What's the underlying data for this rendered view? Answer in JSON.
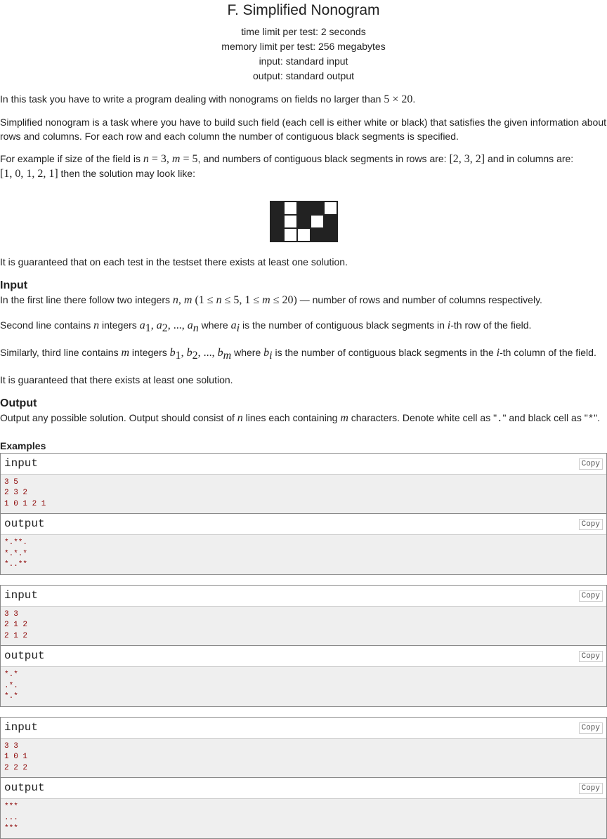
{
  "problem": {
    "title": "F. Simplified Nonogram",
    "time_limit": "time limit per test: 2 seconds",
    "memory_limit": "memory limit per test: 256 megabytes",
    "input_file": "input: standard input",
    "output_file": "output: standard output"
  },
  "statement": {
    "p1_a": "In this task you have to write a program dealing with nonograms on fields no larger than ",
    "p1_math": "5 × 20",
    "p1_b": ".",
    "p2": "Simplified nonogram is a task where you have to build such field (each cell is either white or black) that satisfies the given information about rows and columns. For each row and each column the number of contiguous black segments is specified.",
    "p3_a": "For example if size of the field is ",
    "p3_b": ", and numbers of contiguous black segments in rows are: ",
    "p3_rows": "[2, 3, 2]",
    "p3_c": " and in columns are:",
    "p3_cols": "[1, 0, 1, 2, 1]",
    "p3_d": " then the solution may look like:",
    "p4": "It is guaranteed that on each test in the testset there exists at least one solution.",
    "nonogram": [
      [
        "b",
        "w",
        "b",
        "b",
        "w"
      ],
      [
        "b",
        "w",
        "b",
        "w",
        "b"
      ],
      [
        "b",
        "w",
        "w",
        "b",
        "b"
      ]
    ]
  },
  "input_spec": {
    "title": "Input",
    "l1_a": "In the first line there follow two integers ",
    "l1_b": " — number of rows and number of columns respectively.",
    "l2_a": "Second line contains ",
    "l2_b": " integers ",
    "l2_c": " where ",
    "l2_d": " is the number of contiguous black segments in ",
    "l2_e": "-th row of the field.",
    "l3_a": "Similarly, third line contains ",
    "l3_b": " integers ",
    "l3_c": " where ",
    "l3_d": " is the number of contiguous black segments in the ",
    "l3_e": "-th column of the field.",
    "l4": "It is guaranteed that there exists at least one solution."
  },
  "output_spec": {
    "title": "Output",
    "l1_a": "Output any possible solution. Output should consist of ",
    "l1_b": " lines each containing ",
    "l1_c": " characters. Denote white cell as \"",
    "l1_dot": ".",
    "l1_d": "\" and black cell as \"",
    "l1_star": "*",
    "l1_e": "\"."
  },
  "examples": {
    "title": "Examples",
    "input_label": "input",
    "output_label": "output",
    "copy_label": "Copy",
    "items": [
      {
        "input": "3 5\n2 3 2\n1 0 1 2 1",
        "output": "*.**.\n*.*.*\n*..**"
      },
      {
        "input": "3 3\n2 1 2\n2 1 2",
        "output": "*.*\n.*.\n*.*"
      },
      {
        "input": "3 3\n1 0 1\n2 2 2",
        "output": "***\n...\n***"
      }
    ]
  }
}
